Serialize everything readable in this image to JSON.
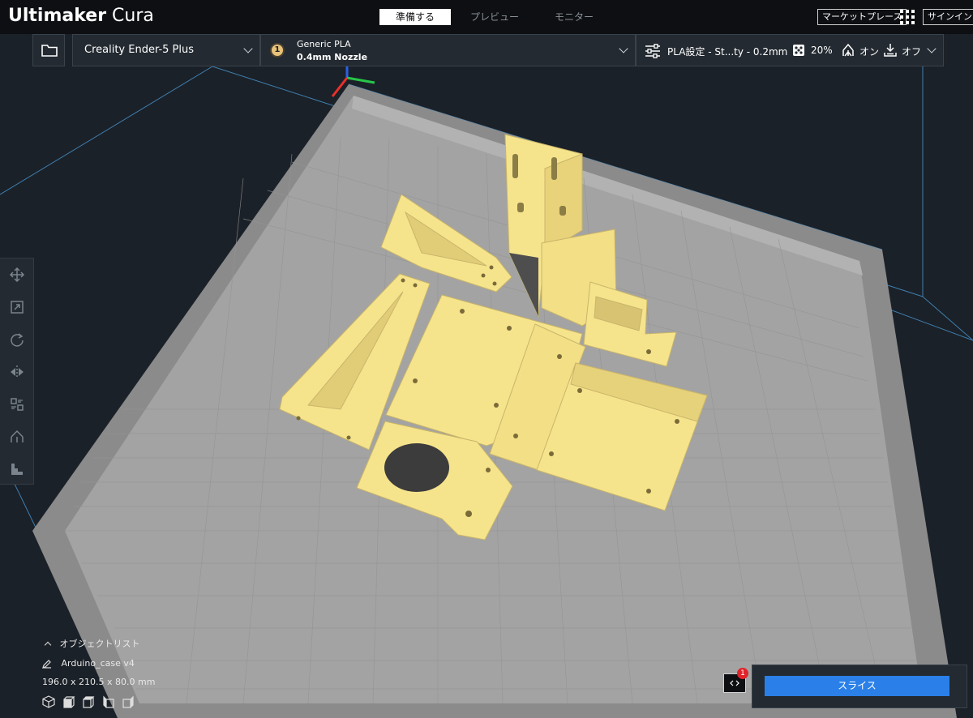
{
  "app": {
    "brand_bold": "Ultimaker",
    "brand_light": "Cura"
  },
  "stages": [
    {
      "label": "準備する",
      "active": true
    },
    {
      "label": "プレビュー",
      "active": false
    },
    {
      "label": "モニター",
      "active": false
    }
  ],
  "header": {
    "marketplace_label": "マーケットプレース",
    "signin_label": "サインイン"
  },
  "printer": {
    "name": "Creality Ender-5 Plus"
  },
  "extruder": {
    "number": "1",
    "material": "Generic PLA",
    "nozzle": "0.4mm Nozzle"
  },
  "print_settings": {
    "profile": "PLA設定 - St...ty - 0.2mm",
    "infill": "20%",
    "support": "オン",
    "adhesion": "オフ"
  },
  "object_list": {
    "header": "オブジェクトリスト",
    "object_name": "Arduino_case v4",
    "dimensions": "196.0 x 210.5 x 80.0 mm"
  },
  "slice": {
    "button_label": "スライス",
    "badge_count": "1"
  },
  "colors": {
    "model_yellow": "#f6e48d",
    "accent_blue": "#2a80e8",
    "plate_gray": "#a3a3a3",
    "background": "#1b2128"
  }
}
